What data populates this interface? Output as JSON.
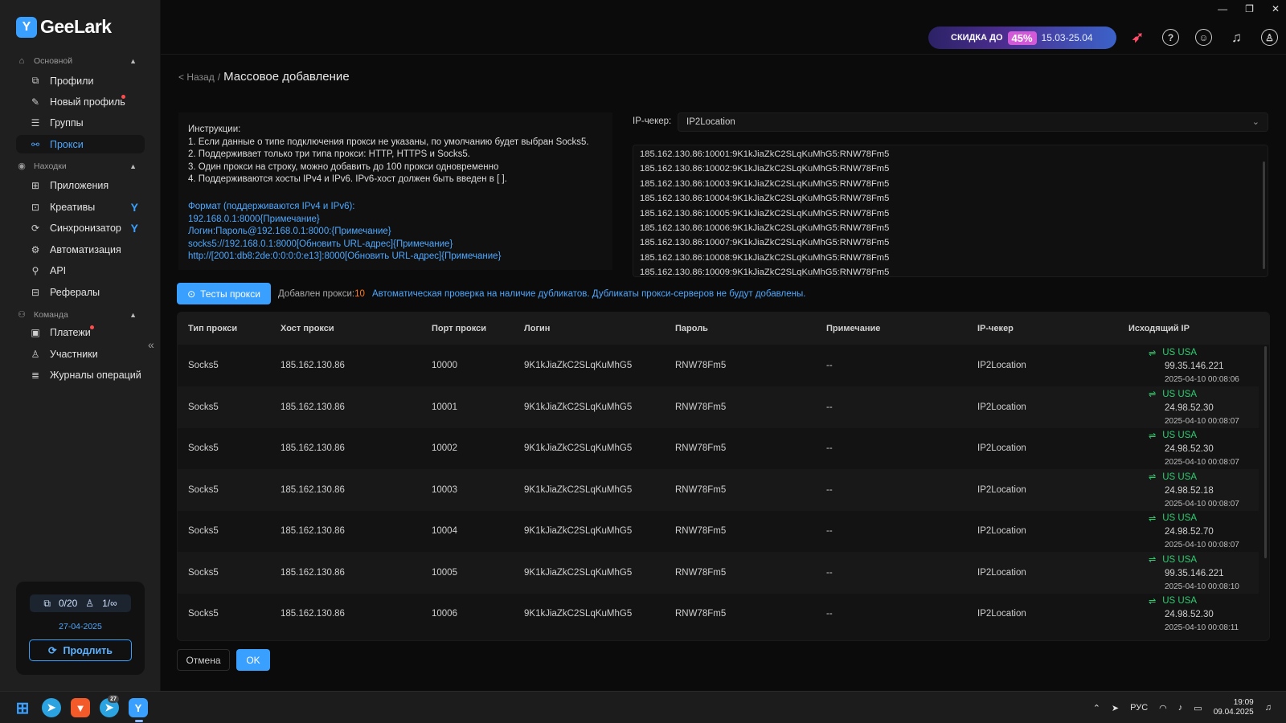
{
  "app": {
    "name": "GeeLark"
  },
  "sidebar": {
    "sections": [
      {
        "label": "Основной"
      },
      {
        "label": "Находки"
      },
      {
        "label": "Команда"
      }
    ],
    "items": [
      {
        "label": "Профили"
      },
      {
        "label": "Новый профиль"
      },
      {
        "label": "Группы"
      },
      {
        "label": "Прокси"
      },
      {
        "label": "Приложения"
      },
      {
        "label": "Креативы"
      },
      {
        "label": "Синхронизатор"
      },
      {
        "label": "Автоматизация"
      },
      {
        "label": "API"
      },
      {
        "label": "Рефералы"
      },
      {
        "label": "Платежи"
      },
      {
        "label": "Участники"
      },
      {
        "label": "Журналы операций"
      }
    ],
    "plan": {
      "profiles": "0/20",
      "members": "1/∞",
      "date": "27-04-2025",
      "renew_label": "Продлить"
    }
  },
  "topbar": {
    "promo": {
      "label": "СКИДКА ДО",
      "percent": "45%",
      "dates": "15.03-25.04"
    }
  },
  "breadcrumb": {
    "back": "< Назад",
    "sep": "/",
    "title": "Массовое добавление"
  },
  "instructions": {
    "lines": [
      "Инструкции:",
      "1. Если данные о типе подключения прокси не указаны, по умолчанию будет выбран Socks5.",
      "2. Поддерживает только три типа прокси: HTTP, HTTPS и Socks5.",
      "3. Один прокси на строку, можно добавить до 100 прокси одновременно",
      "4. Поддерживаются хосты IPv4 и IPv6. IPv6-хост должен быть введен в [ ]."
    ],
    "format_lines": [
      "Формат (поддерживаются IPv4 и IPv6):",
      "192.168.0.1:8000{Примечание}",
      "Логин:Пароль@192.168.0.1:8000:{Примечание}",
      "socks5://192.168.0.1:8000[Обновить URL-адрес]{Примечание}",
      "http://[2001:db8:2de:0:0:0:0:e13]:8000[Обновить URL-адрес]{Примечание}"
    ]
  },
  "checker": {
    "label": "IP-чекер:",
    "value": "IP2Location"
  },
  "textarea_lines": [
    "185.162.130.86:10001:9K1kJiaZkC2SLqKuMhG5:RNW78Fm5",
    "185.162.130.86:10002:9K1kJiaZkC2SLqKuMhG5:RNW78Fm5",
    "185.162.130.86:10003:9K1kJiaZkC2SLqKuMhG5:RNW78Fm5",
    "185.162.130.86:10004:9K1kJiaZkC2SLqKuMhG5:RNW78Fm5",
    "185.162.130.86:10005:9K1kJiaZkC2SLqKuMhG5:RNW78Fm5",
    "185.162.130.86:10006:9K1kJiaZkC2SLqKuMhG5:RNW78Fm5",
    "185.162.130.86:10007:9K1kJiaZkC2SLqKuMhG5:RNW78Fm5",
    "185.162.130.86:10008:9K1kJiaZkC2SLqKuMhG5:RNW78Fm5",
    "185.162.130.86:10009:9K1kJiaZkC2SLqKuMhG5:RNW78Fm5"
  ],
  "actions": {
    "test_label": "Тесты прокси",
    "added_label": "Добавлен прокси:",
    "added_count": "10",
    "dup_note": "Автоматическая проверка на наличие дубликатов. Дубликаты прокси-серверов не будут добавлены.",
    "cancel_label": "Отмена",
    "ok_label": "OK"
  },
  "table": {
    "headers": [
      "Тип прокси",
      "Хост прокси",
      "Порт прокси",
      "Логин",
      "Пароль",
      "Примечание",
      "IP-чекер",
      "Исходящий IP"
    ],
    "rows": [
      {
        "type": "Socks5",
        "host": "185.162.130.86",
        "port": "10000",
        "login": "9K1kJiaZkC2SLqKuMhG5",
        "password": "RNW78Fm5",
        "note": "--",
        "checker": "IP2Location",
        "country": "US USA",
        "ip": "99.35.146.221",
        "ts": "2025-04-10 00:08:06"
      },
      {
        "type": "Socks5",
        "host": "185.162.130.86",
        "port": "10001",
        "login": "9K1kJiaZkC2SLqKuMhG5",
        "password": "RNW78Fm5",
        "note": "--",
        "checker": "IP2Location",
        "country": "US USA",
        "ip": "24.98.52.30",
        "ts": "2025-04-10 00:08:07"
      },
      {
        "type": "Socks5",
        "host": "185.162.130.86",
        "port": "10002",
        "login": "9K1kJiaZkC2SLqKuMhG5",
        "password": "RNW78Fm5",
        "note": "--",
        "checker": "IP2Location",
        "country": "US USA",
        "ip": "24.98.52.30",
        "ts": "2025-04-10 00:08:07"
      },
      {
        "type": "Socks5",
        "host": "185.162.130.86",
        "port": "10003",
        "login": "9K1kJiaZkC2SLqKuMhG5",
        "password": "RNW78Fm5",
        "note": "--",
        "checker": "IP2Location",
        "country": "US USA",
        "ip": "24.98.52.18",
        "ts": "2025-04-10 00:08:07"
      },
      {
        "type": "Socks5",
        "host": "185.162.130.86",
        "port": "10004",
        "login": "9K1kJiaZkC2SLqKuMhG5",
        "password": "RNW78Fm5",
        "note": "--",
        "checker": "IP2Location",
        "country": "US USA",
        "ip": "24.98.52.70",
        "ts": "2025-04-10 00:08:07"
      },
      {
        "type": "Socks5",
        "host": "185.162.130.86",
        "port": "10005",
        "login": "9K1kJiaZkC2SLqKuMhG5",
        "password": "RNW78Fm5",
        "note": "--",
        "checker": "IP2Location",
        "country": "US USA",
        "ip": "99.35.146.221",
        "ts": "2025-04-10 00:08:10"
      },
      {
        "type": "Socks5",
        "host": "185.162.130.86",
        "port": "10006",
        "login": "9K1kJiaZkC2SLqKuMhG5",
        "password": "RNW78Fm5",
        "note": "--",
        "checker": "IP2Location",
        "country": "US USA",
        "ip": "24.98.52.30",
        "ts": "2025-04-10 00:08:11"
      }
    ]
  },
  "taskbar": {
    "telegram_badge": "27",
    "lang": "РУС",
    "time": "19:09",
    "date": "09.04.2025"
  },
  "colors": {
    "accent": "#3aa0ff",
    "success": "#2ecc71",
    "warning": "#ff7a1a",
    "alert": "#ff4d4f"
  }
}
